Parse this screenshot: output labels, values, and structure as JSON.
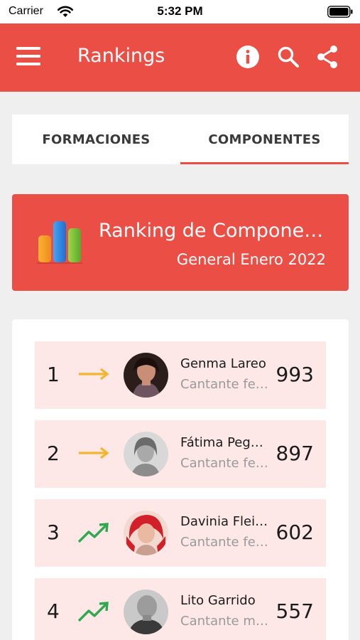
{
  "status_bar": {
    "carrier": "Carrier",
    "time": "5:32 PM"
  },
  "app_bar": {
    "title": "Rankings"
  },
  "tabs": [
    {
      "label": "FORMACIONES",
      "active": false
    },
    {
      "label": "COMPONENTES",
      "active": true
    }
  ],
  "banner": {
    "title": "Ranking de Componentes",
    "subtitle": "General Enero 2022",
    "icon": "bar-chart-icon"
  },
  "ranking": [
    {
      "rank": "1",
      "trend": "same",
      "name": "Genma Lareo",
      "role": "Cantante femenina",
      "score": "993"
    },
    {
      "rank": "2",
      "trend": "same",
      "name": "Fátima Pegueros",
      "role": "Cantante femenina",
      "score": "897"
    },
    {
      "rank": "3",
      "trend": "up",
      "name": "Davinia Fleitas",
      "role": "Cantante femenina",
      "score": "602"
    },
    {
      "rank": "4",
      "trend": "up",
      "name": "Lito Garrido",
      "role": "Cantante masculino",
      "score": "557"
    }
  ],
  "colors": {
    "accent": "#ea4e45",
    "row_bg": "#fde8e7",
    "trend_same": "#f2b52e",
    "trend_up": "#2fa84f"
  }
}
